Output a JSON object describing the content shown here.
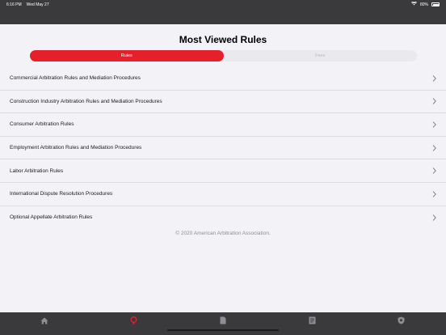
{
  "status_bar": {
    "time": "6:16 PM",
    "date": "Wed May 27",
    "battery": "80%"
  },
  "page": {
    "title": "Most Viewed Rules"
  },
  "segments": [
    {
      "label": "Rules",
      "active": true
    },
    {
      "label": "Fees",
      "active": false
    }
  ],
  "rules": [
    "Commercial Arbitration Rules and Mediation Procedures",
    "Construction Industry Arbitration Rules and Mediation Procedures",
    "Consumer Arbitration Rules",
    "Employment Arbitration Rules and Mediation Procedures",
    "Labor Arbitration Rules",
    "International Dispute Resolution Procedures",
    "Optional Appellate Arbitration Rules"
  ],
  "footer": {
    "copyright": "© 2020 American Arbitration Association."
  },
  "tabs": [
    {
      "icon": "home-icon",
      "active": false
    },
    {
      "icon": "gavel-icon",
      "active": true
    },
    {
      "icon": "folder-icon",
      "active": false
    },
    {
      "icon": "document-icon",
      "active": false
    },
    {
      "icon": "badge-icon",
      "active": false
    }
  ],
  "colors": {
    "accent": "#e5202a",
    "bars": "#3a3a3c",
    "background": "#f2f2f7",
    "tab_inactive": "#8e8e93"
  }
}
